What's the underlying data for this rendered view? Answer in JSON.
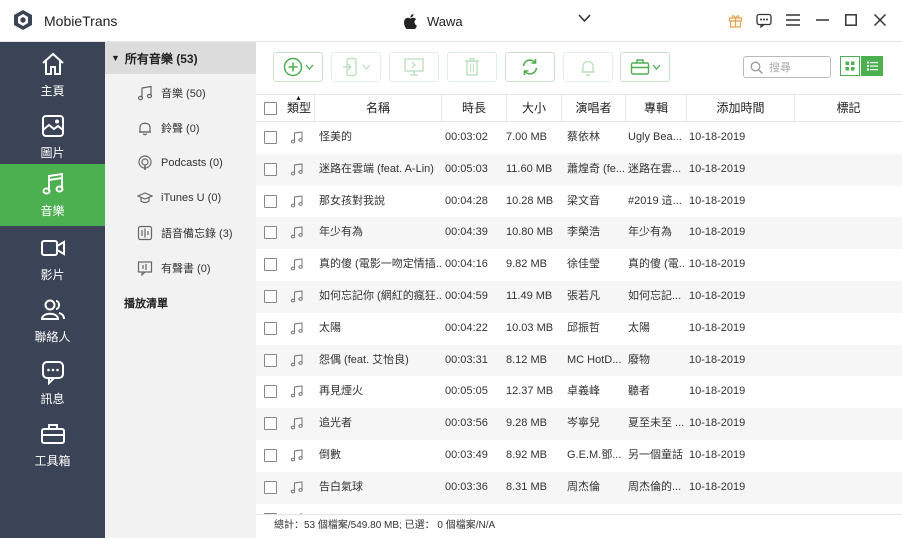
{
  "app": {
    "title": "MobieTrans"
  },
  "device": {
    "name": "Wawa"
  },
  "nav": [
    {
      "key": "home",
      "label": "主頁"
    },
    {
      "key": "photos",
      "label": "圖片"
    },
    {
      "key": "music",
      "label": "音樂"
    },
    {
      "key": "video",
      "label": "影片"
    },
    {
      "key": "contacts",
      "label": "聯絡人"
    },
    {
      "key": "messages",
      "label": "訊息"
    },
    {
      "key": "toolbox",
      "label": "工具箱"
    }
  ],
  "categories": {
    "header": "所有音樂 (53)",
    "items": [
      {
        "icon": "music-note-icon",
        "label": "音樂 (50)"
      },
      {
        "icon": "bell-icon",
        "label": "鈴聲 (0)"
      },
      {
        "icon": "podcast-icon",
        "label": "Podcasts (0)"
      },
      {
        "icon": "graduation-cap-icon",
        "label": "iTunes U (0)"
      },
      {
        "icon": "voice-memo-icon",
        "label": "語音備忘錄 (3)"
      },
      {
        "icon": "audiobook-icon",
        "label": "有聲書 (0)"
      }
    ],
    "playlist": "播放清單"
  },
  "search": {
    "placeholder": "搜尋"
  },
  "table": {
    "columns": {
      "type": "類型",
      "name": "名稱",
      "duration": "時長",
      "size": "大小",
      "artist": "演唱者",
      "album": "專輯",
      "added": "添加時間",
      "tag": "標記"
    },
    "rows": [
      {
        "name": "怪美的",
        "duration": "00:03:02",
        "size": "7.00 MB",
        "artist": "蔡依林",
        "album": "Ugly Bea...",
        "added": "10-18-2019"
      },
      {
        "name": "迷路在雲端 (feat. A-Lin)",
        "duration": "00:05:03",
        "size": "11.60 MB",
        "artist": "蕭煌奇 (fe...",
        "album": "迷路在雲...",
        "added": "10-18-2019"
      },
      {
        "name": "那女孩對我說",
        "duration": "00:04:28",
        "size": "10.28 MB",
        "artist": "梁文音",
        "album": "#2019 這...",
        "added": "10-18-2019"
      },
      {
        "name": "年少有為",
        "duration": "00:04:39",
        "size": "10.80 MB",
        "artist": "李榮浩",
        "album": "年少有為",
        "added": "10-18-2019"
      },
      {
        "name": "真的傻 (電影一吻定情插...",
        "duration": "00:04:16",
        "size": "9.82 MB",
        "artist": "徐佳瑩",
        "album": "真的傻 (電...",
        "added": "10-18-2019"
      },
      {
        "name": "如何忘記你 (網紅的瘋狂...",
        "duration": "00:04:59",
        "size": "11.49 MB",
        "artist": "張若凡",
        "album": "如何忘記...",
        "added": "10-18-2019"
      },
      {
        "name": "太陽",
        "duration": "00:04:22",
        "size": "10.03 MB",
        "artist": "邱振哲",
        "album": "太陽",
        "added": "10-18-2019"
      },
      {
        "name": "怨偶 (feat. 艾怡良)",
        "duration": "00:03:31",
        "size": "8.12 MB",
        "artist": "MC HotD...",
        "album": "廢物",
        "added": "10-18-2019"
      },
      {
        "name": "再見煙火",
        "duration": "00:05:05",
        "size": "12.37 MB",
        "artist": "卓義峰",
        "album": "聽者",
        "added": "10-18-2019"
      },
      {
        "name": "追光者",
        "duration": "00:03:56",
        "size": "9.28 MB",
        "artist": "岑寧兒",
        "album": "夏至未至 ...",
        "added": "10-18-2019"
      },
      {
        "name": "倒數",
        "duration": "00:03:49",
        "size": "8.92 MB",
        "artist": "G.E.M.鄧...",
        "album": "另一個童話",
        "added": "10-18-2019"
      },
      {
        "name": "告白氣球",
        "duration": "00:03:36",
        "size": "8.31 MB",
        "artist": "周杰倫",
        "album": "周杰倫的...",
        "added": "10-18-2019"
      },
      {
        "name": "",
        "duration": "",
        "size": "",
        "artist": "",
        "album": "",
        "added": ""
      }
    ]
  },
  "status": {
    "text": "總計：53 個檔案/549.80 MB; 已選： 0 個檔案/N/A"
  },
  "colors": {
    "accent": "#4caf50",
    "nav_bg": "#3b4456"
  }
}
